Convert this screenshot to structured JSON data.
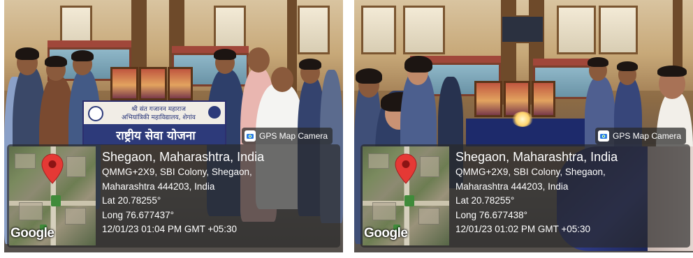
{
  "photos": [
    {
      "banner": {
        "line1": "श्री संत गजानन महाराज",
        "line2": "अभियांत्रिकी महाविद्यालय, शेगांव",
        "title": "राष्ट्रीय सेवा योजना"
      },
      "gps": {
        "app_label": "GPS Map Camera",
        "map_logo": "Google",
        "city": "Shegaon, Maharashtra, India",
        "address_line1": "QMMG+2X9, SBI Colony, Shegaon,",
        "address_line2": "Maharashtra 444203, India",
        "lat": "Lat 20.78255°",
        "long": "Long 76.677437°",
        "datetime": "12/01/23 01:04 PM GMT +05:30"
      }
    },
    {
      "gps": {
        "app_label": "GPS Map Camera",
        "map_logo": "Google",
        "city": "Shegaon, Maharashtra, India",
        "address_line1": "QMMG+2X9, SBI Colony, Shegaon,",
        "address_line2": "Maharashtra 444203, India",
        "lat": "Lat 20.78255°",
        "long": "Long 76.677438°",
        "datetime": "12/01/23 01:02 PM GMT +05:30"
      }
    }
  ],
  "icons": {
    "camera_app": "gps-map-camera-icon",
    "location": "location-pin-icon"
  },
  "colors": {
    "overlay_bg": "#2a2a2a",
    "pin_red": "#e53935",
    "banner_blue": "#2d3a7a"
  }
}
